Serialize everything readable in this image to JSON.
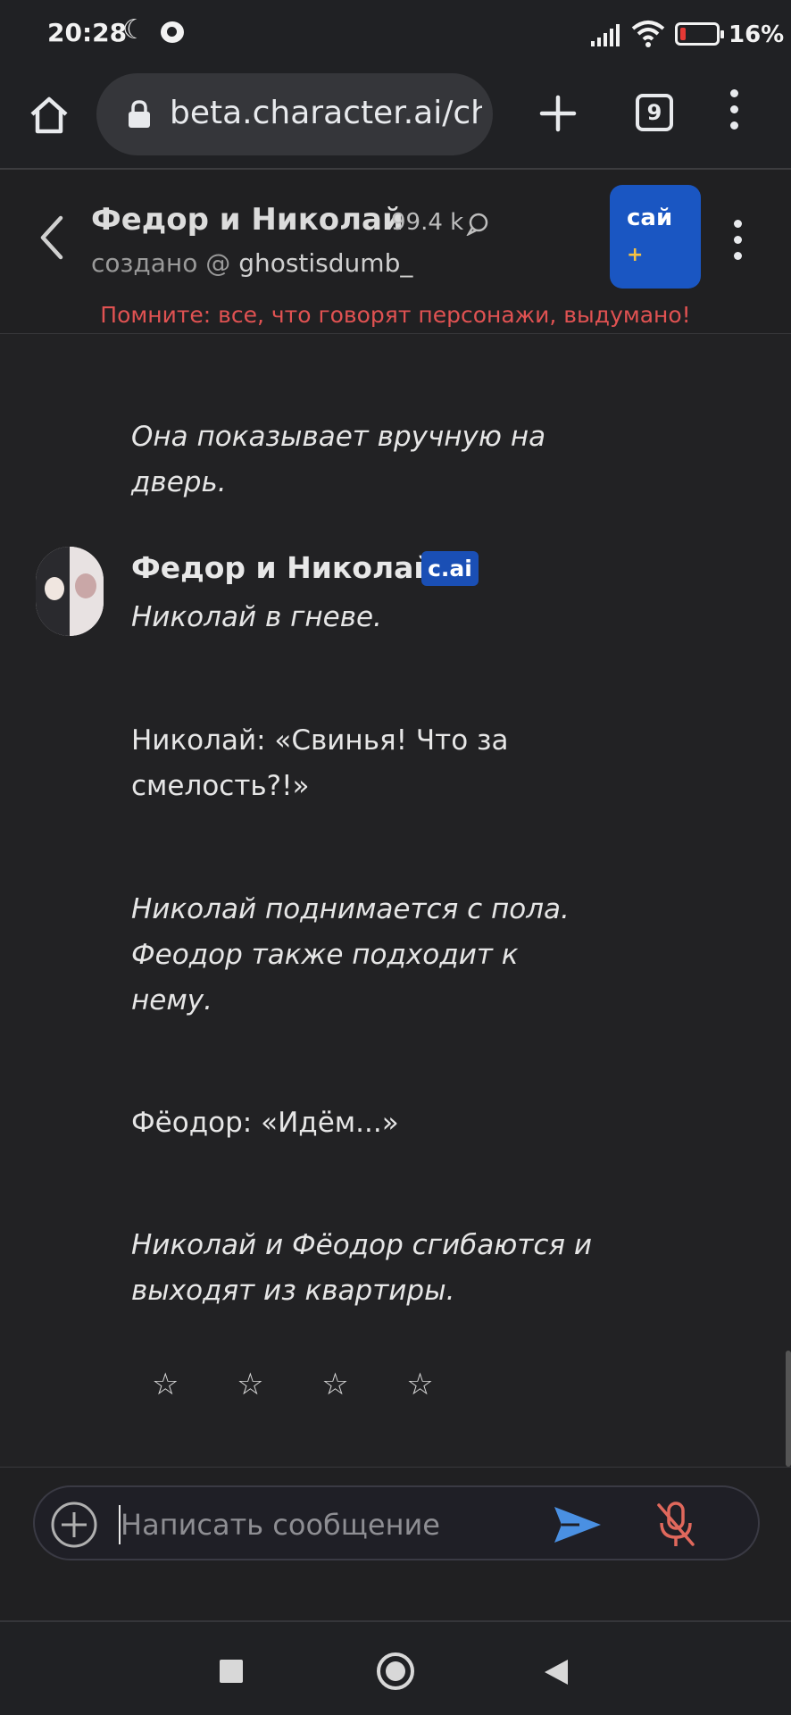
{
  "status_bar": {
    "time": "20:28",
    "battery_text": "16%",
    "battery_level_percent": 16,
    "icons": [
      "moon-icon",
      "notification-icon",
      "signal-icon",
      "wifi-icon",
      "battery-icon"
    ]
  },
  "browser": {
    "url": "beta.character.ai/chat",
    "tab_count": "9",
    "icons": [
      "home-icon",
      "lock-icon",
      "new-tab-plus-icon",
      "tabs-count-icon",
      "more-vert-icon"
    ]
  },
  "chat_header": {
    "character_name": "Федор и Николай",
    "interaction_count": "99.4 k",
    "creator_prefix": "создано @",
    "creator_name": "ghostisdumb_",
    "plus_badge_label": "сай",
    "plus_badge_symbol": "+",
    "warning": "Помните: все, что говорят персонажи, выдумано!",
    "accent_color": "#1a56c2",
    "warning_color": "#e05252"
  },
  "messages": {
    "previous_tail": "Она показывает вручную на дверь.",
    "sender_name": "Федор и Николай",
    "sender_badge": "c.ai",
    "paragraphs": [
      {
        "text": "Николай в гневе.",
        "italic": true
      },
      {
        "text": "Николай: «Свинья! Что за смелость?!»",
        "italic": false
      },
      {
        "text": "Николай поднимается с пола. Феодор также подходит к нему.",
        "italic": true
      },
      {
        "text": "Фёодор: «Идём...»",
        "italic": false
      },
      {
        "text": "Николай и Фёодор сгибаются и выходят из квартиры.",
        "italic": true
      }
    ],
    "rating_stars": [
      "☆",
      "☆",
      "☆",
      "☆"
    ]
  },
  "composer": {
    "placeholder": "Написать сообщение",
    "send_color": "#4a90e2",
    "mic_color": "#e0685c"
  }
}
